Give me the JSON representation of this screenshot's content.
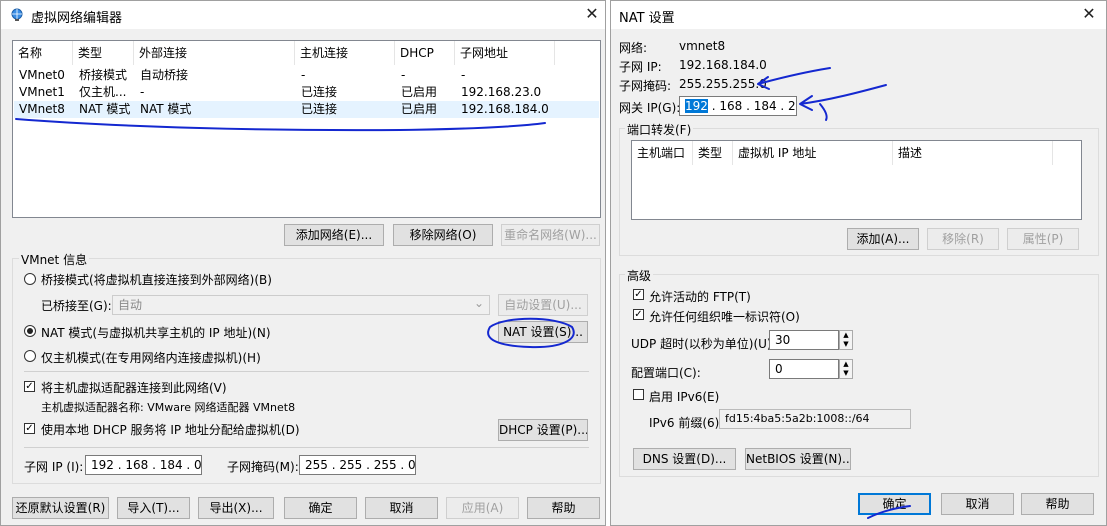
{
  "left_window": {
    "title": "虚拟网络编辑器",
    "close": "✕",
    "table": {
      "headers": [
        "名称",
        "类型",
        "外部连接",
        "主机连接",
        "DHCP",
        "子网地址"
      ],
      "rows": [
        [
          "VMnet0",
          "桥接模式",
          "自动桥接",
          "-",
          "-",
          "-"
        ],
        [
          "VMnet1",
          "仅主机...",
          "-",
          "已连接",
          "已启用",
          "192.168.23.0"
        ],
        [
          "VMnet8",
          "NAT 模式",
          "NAT 模式",
          "已连接",
          "已启用",
          "192.168.184.0"
        ]
      ]
    },
    "buttons": {
      "add_network": "添加网络(E)...",
      "remove_network": "移除网络(O)",
      "rename_network": "重命名网络(W)..."
    },
    "vmnet_info": {
      "legend": "VMnet 信息",
      "bridge_mode": "桥接模式(将虚拟机直接连接到外部网络)(B)",
      "bridged_to_label": "已桥接至(G):",
      "bridged_to_value": "自动",
      "auto_settings": "自动设置(U)...",
      "nat_mode": "NAT 模式(与虚拟机共享主机的 IP 地址)(N)",
      "nat_settings": "NAT 设置(S)...",
      "host_only_mode": "仅主机模式(在专用网络内连接虚拟机)(H)",
      "connect_adapter": "将主机虚拟适配器连接到此网络(V)",
      "adapter_name": "主机虚拟适配器名称: VMware 网络适配器 VMnet8",
      "use_dhcp": "使用本地 DHCP 服务将 IP 地址分配给虚拟机(D)",
      "dhcp_settings": "DHCP 设置(P)...",
      "subnet_ip_label": "子网 IP (I):",
      "subnet_ip_value": "192 . 168 . 184 .  0",
      "subnet_mask_label": "子网掩码(M):",
      "subnet_mask_value": "255 . 255 . 255 .  0"
    },
    "bottom_buttons": {
      "restore": "还原默认设置(R)",
      "import": "导入(T)...",
      "export": "导出(X)...",
      "ok": "确定",
      "cancel": "取消",
      "apply": "应用(A)",
      "help": "帮助"
    }
  },
  "nat_window": {
    "title": "NAT 设置",
    "close": "✕",
    "network_label": "网络:",
    "network_value": "vmnet8",
    "subnet_ip_label": "子网 IP:",
    "subnet_ip_value": "192.168.184.0",
    "subnet_mask_label": "子网掩码:",
    "subnet_mask_value": "255.255.255.0",
    "gateway_label": "网关 IP(G):",
    "gateway_first": "192",
    "gateway_rest": " . 168 . 184 .  2",
    "port_forward": {
      "legend": "端口转发(F)",
      "headers": [
        "主机端口",
        "类型",
        "虚拟机 IP 地址",
        "描述"
      ],
      "add": "添加(A)...",
      "remove": "移除(R)",
      "properties": "属性(P)"
    },
    "advanced": {
      "legend": "高级",
      "allow_ftp": "允许活动的 FTP(T)",
      "allow_org_id": "允许任何组织唯一标识符(O)",
      "udp_timeout_label": "UDP 超时(以秒为单位)(U):",
      "udp_timeout_value": "30",
      "config_port_label": "配置端口(C):",
      "config_port_value": "0",
      "enable_ipv6": "启用 IPv6(E)",
      "ipv6_prefix_label": "IPv6 前缀(6):",
      "ipv6_prefix_value": "fd15:4ba5:5a2b:1008::/64",
      "dns_settings": "DNS 设置(D)...",
      "netbios_settings": "NetBIOS 设置(N)..."
    },
    "buttons": {
      "ok": "确定",
      "cancel": "取消",
      "help": "帮助"
    }
  },
  "colors": {
    "annotation": "#1428d0",
    "accent": "#0078d7",
    "window_bg": "#f0f0f0"
  },
  "icons": {
    "title_icon": "globe-network-icon",
    "check": "✓",
    "spin_up": "▲",
    "spin_down": "▼",
    "dropdown": "⌄"
  }
}
